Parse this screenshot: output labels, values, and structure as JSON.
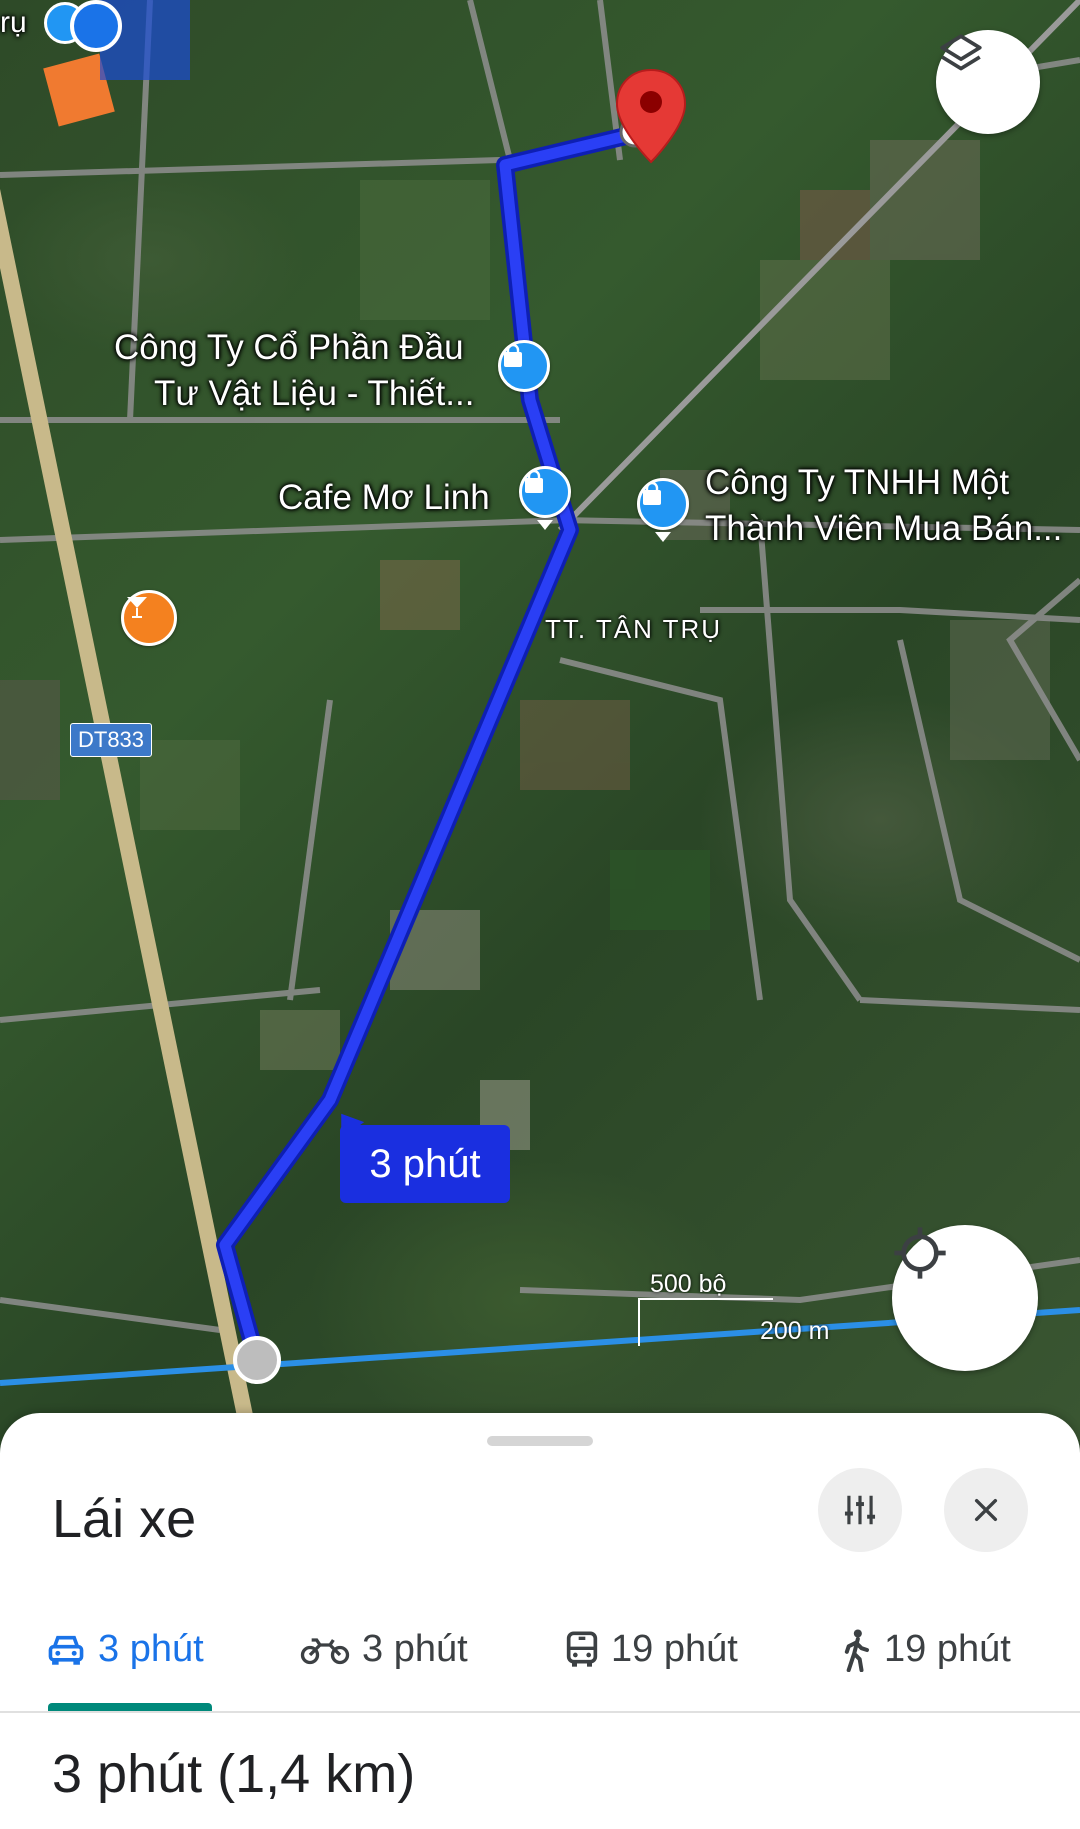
{
  "map": {
    "places": {
      "cong_ty_dau_tu_line1": "Công Ty Cổ Phần Đầu",
      "cong_ty_dau_tu_line2": "Tư Vật Liệu - Thiết...",
      "cafe": "Cafe Mơ Linh",
      "cong_ty_tnhh_line1": "Công Ty TNHH Một",
      "cong_ty_tnhh_line2": "Thành Viên Mua Bán...",
      "top_left_fragment": "rụ"
    },
    "area_label": "TT. TÂN TRỤ",
    "road_shield": "DT833",
    "route_time": "3 phút",
    "scale": {
      "imperial": "500 bộ",
      "metric": "200 m"
    },
    "icons": {
      "layers": "layers-icon",
      "my_location": "my-location-icon",
      "destination": "red-pin-icon",
      "shopping": "shopping-bag-icon",
      "bar": "cocktail-icon"
    },
    "colors": {
      "route": "#1a2fe0",
      "poi_blue": "#2196f3",
      "poi_orange": "#f4811f",
      "destination_pin": "#e53935"
    }
  },
  "sheet": {
    "title": "Lái xe",
    "tabs": [
      {
        "icon": "car-icon",
        "label": "3 phút",
        "active": true
      },
      {
        "icon": "motorbike-icon",
        "label": "3 phút",
        "active": false
      },
      {
        "icon": "transit-icon",
        "label": "19 phút",
        "active": false
      },
      {
        "icon": "walk-icon",
        "label": "19 phút",
        "active": false
      }
    ],
    "summary": {
      "time": "3 phút",
      "distance": "(1,4 km)"
    },
    "accent_color": "#1a73e8",
    "active_underline_color": "#00897b"
  }
}
